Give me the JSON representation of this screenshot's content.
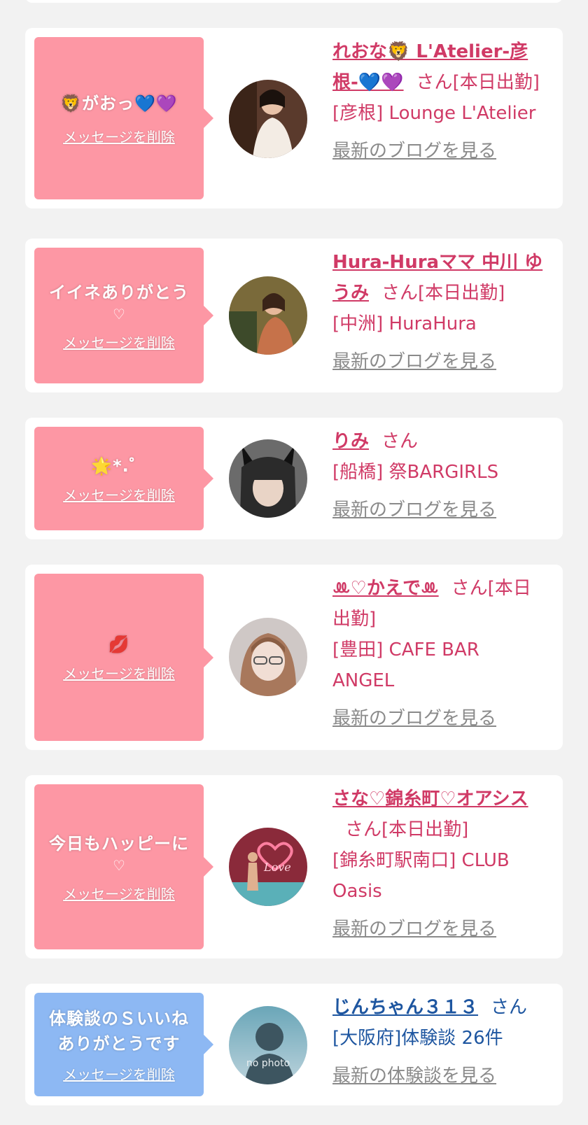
{
  "cards": [
    {
      "message": "🦁がおっ💙💜",
      "delete_label": "メッセージを削除",
      "name": "れおな🦁 L'Atelier-彦根-💙💜",
      "honorific": "さん",
      "status": "[本日出勤]",
      "shop": "[彦根] Lounge L'Atelier",
      "link": "最新のブログを見る"
    },
    {
      "message": "イイネありがとう",
      "heart": "♡",
      "delete_label": "メッセージを削除",
      "name": "Hura-Huraママ 中川 ゆうみ",
      "honorific": "さん",
      "status": "[本日出勤]",
      "shop": "[中洲] HuraHura",
      "link": "最新のブログを見る"
    },
    {
      "message": "🌟*.゜",
      "delete_label": "メッセージを削除",
      "name": "りみ",
      "honorific": "さん",
      "shop": "[船橋] 祭BARGIRLS",
      "link": "最新のブログを見る"
    },
    {
      "message": "💋",
      "delete_label": "メッセージを削除",
      "name": "ꔛ♡かえでꔛ",
      "honorific": "さん",
      "status": "[本日出勤]",
      "shop": "[豊田] CAFE BAR ANGEL",
      "link": "最新のブログを見る"
    },
    {
      "message": "今日もハッピーに",
      "heart": "♡",
      "delete_label": "メッセージを削除",
      "name": "さな♡錦糸町♡オアシス",
      "honorific": "さん",
      "status": "[本日出勤]",
      "shop": "[錦糸町駅南口] CLUB Oasis",
      "link": "最新のブログを見る"
    },
    {
      "message": "体験談のＳいいね ありがとうです",
      "delete_label": "メッセージを削除",
      "name": "じんちゃん３１３",
      "honorific": "さん",
      "shop": "[大阪府]体験談 26件",
      "link": "最新の体験談を見る",
      "avatar_text": "no photo"
    }
  ],
  "colors": {
    "bubble_pink": "#fd97a4",
    "bubble_blue": "#8db8f3",
    "name_pink": "#d03a66",
    "name_blue": "#1e56a0",
    "link_gray": "#8a8a8a"
  }
}
